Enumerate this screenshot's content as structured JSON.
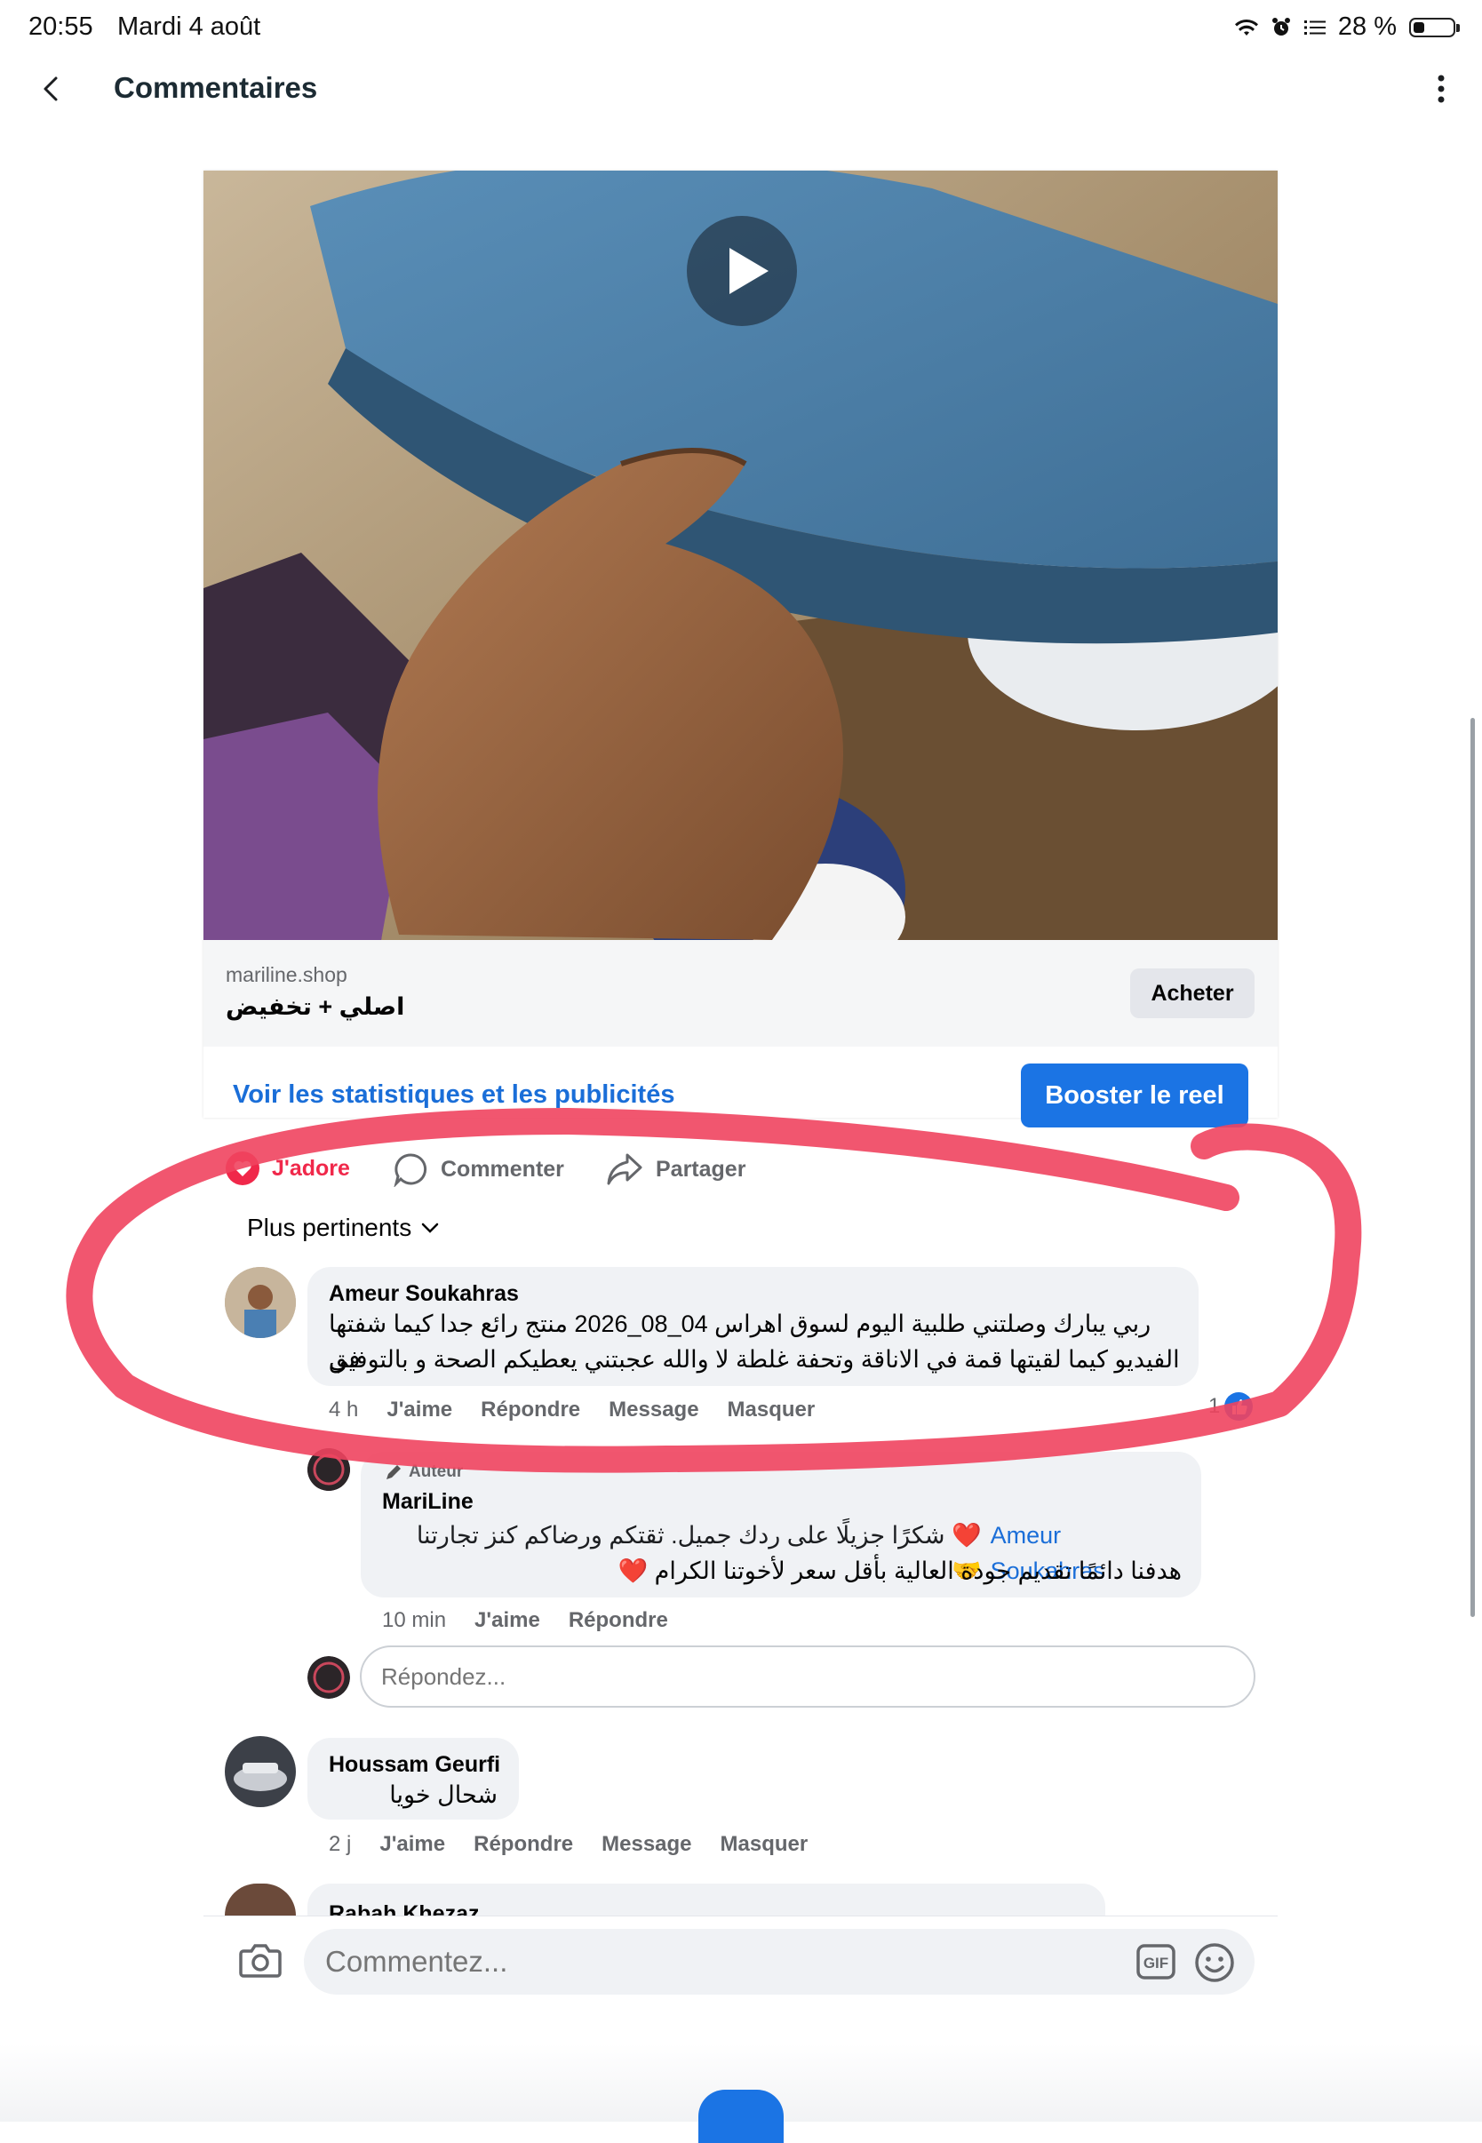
{
  "status_bar": {
    "time": "20:55",
    "date": "Mardi 4 août",
    "battery_text": "28 %",
    "battery_level": 0.28
  },
  "header": {
    "title": "Commentaires"
  },
  "post": {
    "domain": "mariline.shop",
    "link_title": "اصلي + تخفيض",
    "buy_label": "Acheter",
    "stats_link": "Voir les statistiques et les publicités",
    "boost_label": "Booster le reel",
    "actions": {
      "love": "J'adore",
      "comment": "Commenter",
      "share": "Partager"
    }
  },
  "sort_label": "Plus pertinents",
  "comments": [
    {
      "name": "Ameur Soukahras",
      "text_line1": "ربي يبارك وصلتني طلبية اليوم لسوق اهراس 04_08_2026 منتج رائع جدا كيما شفتها في",
      "text_line2": "الفيديو كيما لقيتها قمة في الاناقة وتحفة غلطة لا والله عجبتني يعطيكم الصحة و بالتوفيق",
      "time": "4 h",
      "like": "J'aime",
      "reply": "Répondre",
      "message": "Message",
      "hide": "Masquer",
      "reaction_count": "1"
    },
    {
      "author_badge": "Auteur",
      "name": "MariLine",
      "mention": "Ameur Soukahras",
      "text_line1": "❤️ شكرًا جزيلًا على ردك جميل. ثقتكم ورضاكم كنز تجارتنا 🤝",
      "text_line2": "هدفنا دائمًا تقديم جودة العالية بأقل سعر  لأخوتنا الكرام ❤️",
      "time": "10 min",
      "like": "J'aime",
      "reply": "Répondre"
    },
    {
      "name": "Houssam Geurfi",
      "text": "شحال خويا",
      "time": "2 j",
      "like": "J'aime",
      "reply": "Répondre",
      "message": "Message",
      "hide": "Masquer"
    },
    {
      "name": "Rabah Khezaz"
    }
  ],
  "reply_placeholder": "Répondez...",
  "composer_placeholder": "Commentez...",
  "colors": {
    "accent": "#1b74e4",
    "love": "#f0284a",
    "annotation": "#f0445f"
  }
}
